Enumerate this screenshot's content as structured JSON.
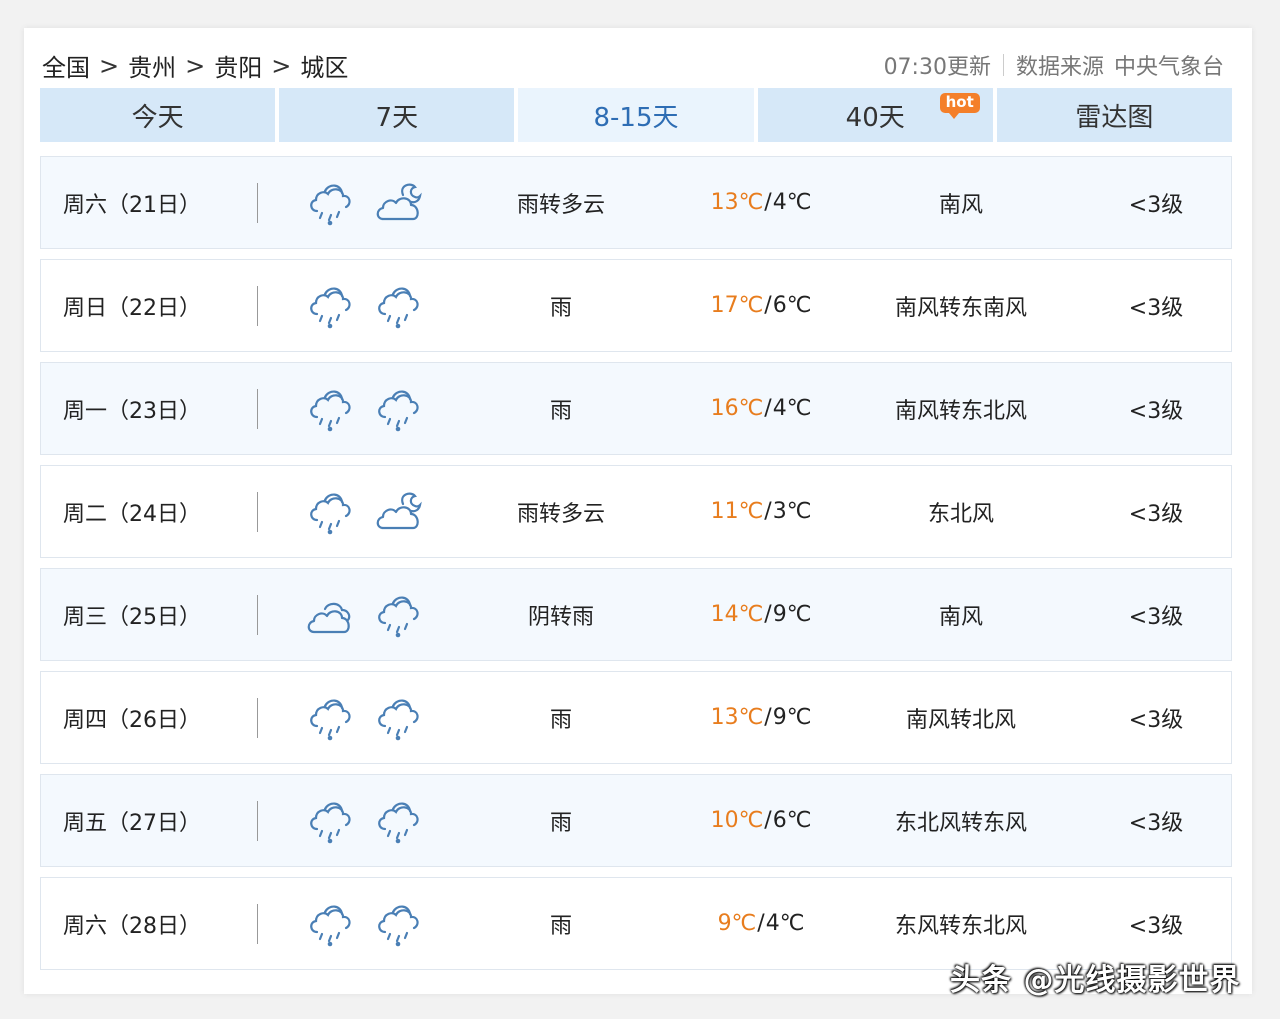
{
  "breadcrumb": [
    "全国",
    "贵州",
    "贵阳",
    "城区"
  ],
  "breadcrumb_separator": ">",
  "meta": {
    "updated": "07:30更新",
    "source_label": "数据来源",
    "source": "中央气象台"
  },
  "tabs": [
    {
      "label": "今天",
      "active": false
    },
    {
      "label": "7天",
      "active": false
    },
    {
      "label": "8-15天",
      "active": true
    },
    {
      "label": "40天",
      "active": false,
      "badge": "hot"
    },
    {
      "label": "雷达图",
      "active": false
    }
  ],
  "days": [
    {
      "date": "周六（21日）",
      "icon_day": "rain-cloud-icon",
      "icon_night": "partly-cloudy-night-icon",
      "weather": "雨转多云",
      "high": "13℃",
      "low": "4℃",
      "wind": "南风",
      "level": "<3级"
    },
    {
      "date": "周日（22日）",
      "icon_day": "rain-cloud-icon",
      "icon_night": "rain-cloud-icon",
      "weather": "雨",
      "high": "17℃",
      "low": "6℃",
      "wind": "南风转东南风",
      "level": "<3级"
    },
    {
      "date": "周一（23日）",
      "icon_day": "rain-cloud-icon",
      "icon_night": "rain-cloud-icon",
      "weather": "雨",
      "high": "16℃",
      "low": "4℃",
      "wind": "南风转东北风",
      "level": "<3级"
    },
    {
      "date": "周二（24日）",
      "icon_day": "rain-cloud-icon",
      "icon_night": "partly-cloudy-night-icon",
      "weather": "雨转多云",
      "high": "11℃",
      "low": "3℃",
      "wind": "东北风",
      "level": "<3级"
    },
    {
      "date": "周三（25日）",
      "icon_day": "overcast-icon",
      "icon_night": "rain-cloud-icon",
      "weather": "阴转雨",
      "high": "14℃",
      "low": "9℃",
      "wind": "南风",
      "level": "<3级"
    },
    {
      "date": "周四（26日）",
      "icon_day": "rain-cloud-icon",
      "icon_night": "rain-cloud-icon",
      "weather": "雨",
      "high": "13℃",
      "low": "9℃",
      "wind": "南风转北风",
      "level": "<3级"
    },
    {
      "date": "周五（27日）",
      "icon_day": "rain-cloud-icon",
      "icon_night": "rain-cloud-icon",
      "weather": "雨",
      "high": "10℃",
      "low": "6℃",
      "wind": "东北风转东风",
      "level": "<3级"
    },
    {
      "date": "周六（28日）",
      "icon_day": "rain-cloud-icon",
      "icon_night": "rain-cloud-icon",
      "weather": "雨",
      "high": "9℃",
      "low": "4℃",
      "wind": "东风转东北风",
      "level": "<3级"
    }
  ],
  "watermark": "头条 @光线摄影世界",
  "colors": {
    "tab_bg": "#d6e8f8",
    "tab_active_bg": "#eaf4fd",
    "tab_active_text": "#2e6db4",
    "high_temp": "#e87d1e",
    "hot_badge": "#f47f2a",
    "row_alt_bg": "#f4f9fe",
    "icon_stroke": "#4a7fb5"
  }
}
